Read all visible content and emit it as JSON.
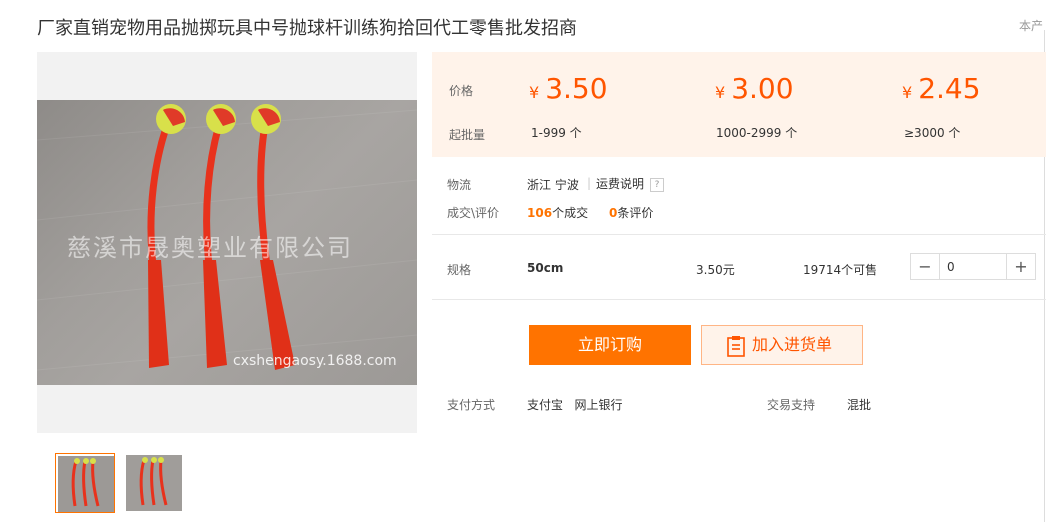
{
  "product": {
    "title": "厂家直销宠物用品抛掷玩具中号抛球杆训练狗拾回代工零售批发招商",
    "corner_text": "本产"
  },
  "gallery": {
    "watermark_main": "慈溪市晟奥塑业有限公司",
    "watermark_url": "cxshengaosy.1688.com",
    "thumbnails": 2,
    "active_thumbnail": 1
  },
  "price": {
    "price_label": "价格",
    "moq_label": "起批量",
    "currency": "¥",
    "tiers": [
      {
        "price": "3.50",
        "qty": "1-999 个"
      },
      {
        "price": "3.00",
        "qty": "1000-2999 个"
      },
      {
        "price": "2.45",
        "qty": "≥3000 个"
      }
    ]
  },
  "logistics": {
    "label": "物流",
    "location": "浙江 宁波",
    "freight_link": "运费说明",
    "help_icon": "?"
  },
  "deals": {
    "label": "成交\\评价",
    "count": "106",
    "count_suffix": "个成交",
    "reviews": "0",
    "reviews_suffix": "条评价"
  },
  "spec": {
    "label": "规格",
    "name": "50cm",
    "price": "3.50元",
    "stock": "19714个可售",
    "quantity": "0",
    "minus": "−",
    "plus": "+"
  },
  "actions": {
    "buy": "立即订购",
    "cart": "加入进货单"
  },
  "payment": {
    "label": "支付方式",
    "methods": "支付宝   网上银行",
    "support_label": "交易支持",
    "support_value": "混批"
  },
  "colors": {
    "accent": "#ff7300",
    "price": "#ff5500",
    "price_bg": "#fff3ea"
  }
}
